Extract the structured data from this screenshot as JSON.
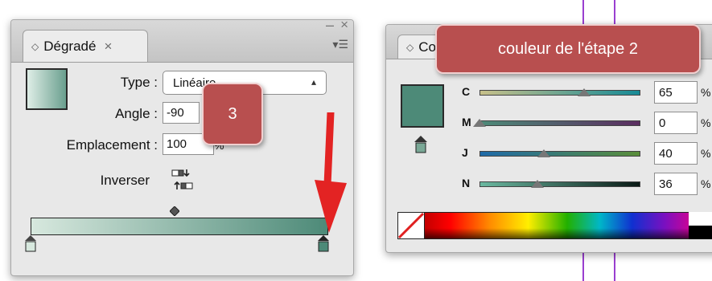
{
  "gradient_panel": {
    "tab_label": "Dégradé",
    "type_label": "Type :",
    "type_value": "Linéaire",
    "angle_label": "Angle :",
    "angle_value": "-90",
    "location_label": "Emplacement :",
    "location_value": "100",
    "location_unit": "%",
    "reverse_label": "Inverser",
    "colors": {
      "start": "#d4e4dc",
      "end": "#4d8a78"
    }
  },
  "callout_step": "3",
  "callout_color": "couleur de l'étape 2",
  "color_panel": {
    "tab_label": "Co",
    "swatch_color": "#4d8a78",
    "sliders": [
      {
        "label": "C",
        "value": "65",
        "unit": "%",
        "level": 0.65,
        "track": [
          "#c7c08a",
          "#168a96"
        ]
      },
      {
        "label": "M",
        "value": "0",
        "unit": "%",
        "level": 0.0,
        "track": [
          "#4d8a78",
          "#5a2d60"
        ]
      },
      {
        "label": "J",
        "value": "40",
        "unit": "%",
        "level": 0.4,
        "track": [
          "#1e6aa8",
          "#5a8e3a"
        ]
      },
      {
        "label": "N",
        "value": "36",
        "unit": "%",
        "level": 0.36,
        "track": [
          "#6ab8a0",
          "#0a1a16"
        ]
      }
    ]
  },
  "accent_colors": {
    "callout": "#b84f4f",
    "arrow": "#e32323",
    "guide": "#9a3fd0"
  }
}
